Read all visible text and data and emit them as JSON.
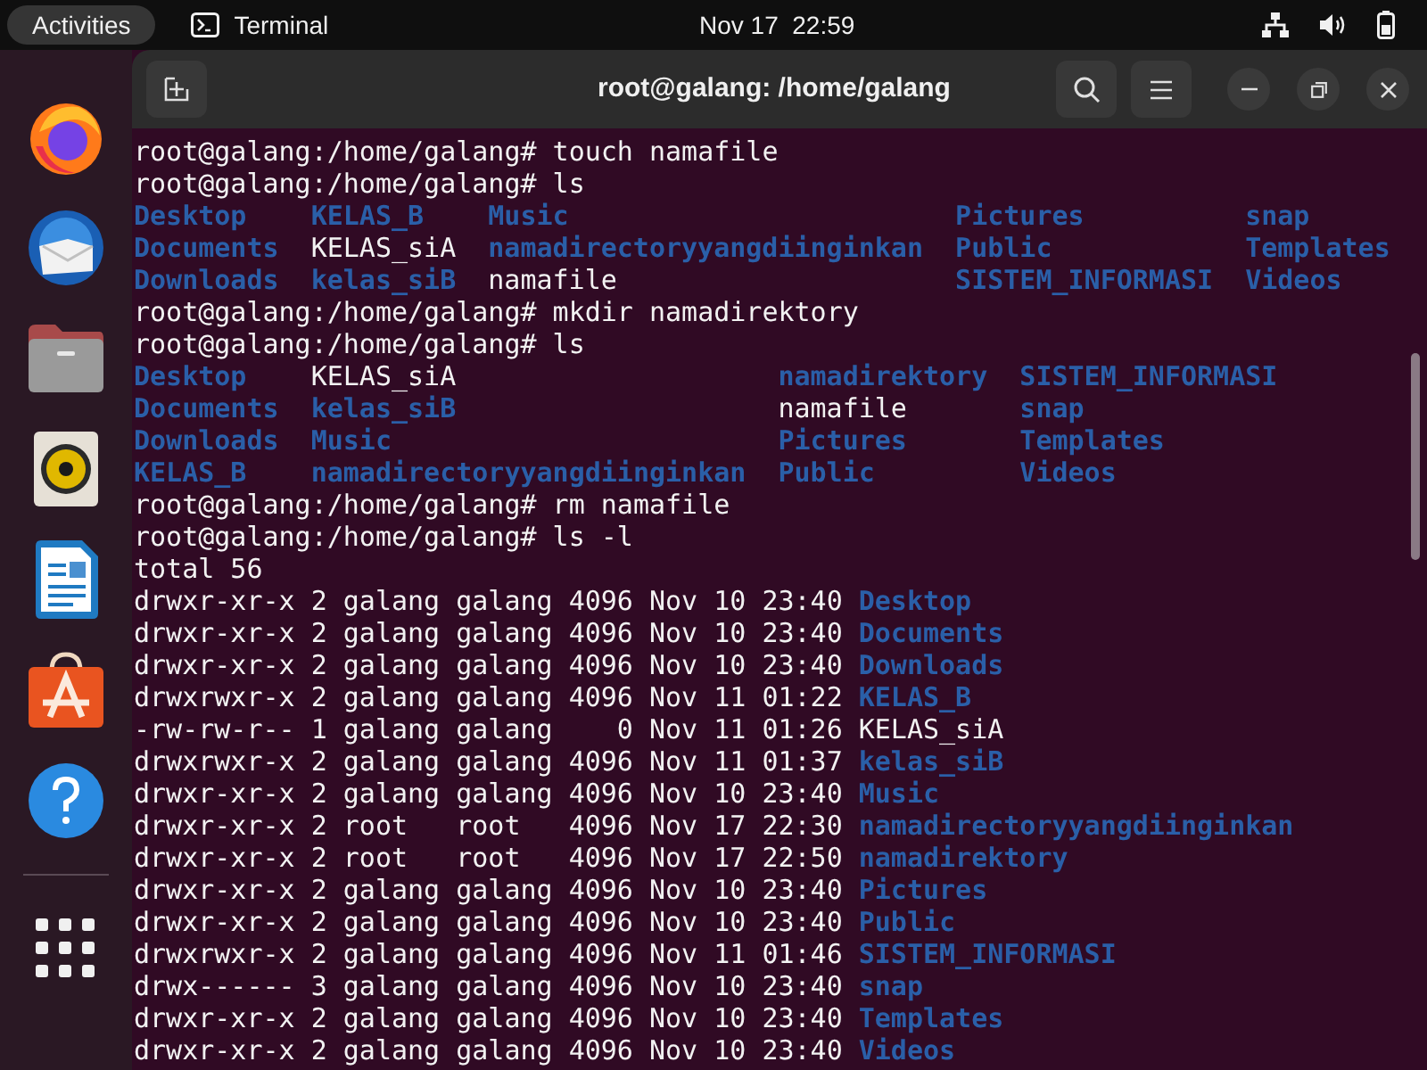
{
  "top_bar": {
    "activities": "Activities",
    "app_name": "Terminal",
    "clock": "Nov 17  22:59"
  },
  "dock": {
    "apps": [
      {
        "kind": "firefox",
        "selected": false
      },
      {
        "kind": "thunderbird",
        "selected": false
      },
      {
        "kind": "files",
        "selected": false
      },
      {
        "kind": "rhythmbox",
        "selected": false
      },
      {
        "kind": "writer",
        "selected": false
      },
      {
        "kind": "appcenter",
        "selected": false
      },
      {
        "kind": "help",
        "selected": false
      }
    ]
  },
  "window": {
    "title": "root@galang: /home/galang"
  },
  "terminal": {
    "lines": [
      {
        "kind": "prompt",
        "prompt": "root@galang:/home/galang#",
        "command": "touch namafile"
      },
      {
        "kind": "prompt",
        "prompt": "root@galang:/home/galang#",
        "command": "ls"
      },
      {
        "kind": "grid",
        "rows": [
          [
            {
              "name": "Desktop",
              "directory": true
            },
            {
              "name": "KELAS_B",
              "directory": true
            },
            {
              "name": "Music",
              "directory": true
            },
            {
              "name": "Pictures",
              "directory": true
            },
            {
              "name": "snap",
              "directory": true
            }
          ],
          [
            {
              "name": "Documents",
              "directory": true
            },
            {
              "name": "KELAS_siA",
              "directory": false
            },
            {
              "name": "namadirectoryyangdiinginkan",
              "directory": true
            },
            {
              "name": "Public",
              "directory": true
            },
            {
              "name": "Templates",
              "directory": true
            }
          ],
          [
            {
              "name": "Downloads",
              "directory": true
            },
            {
              "name": "kelas_siB",
              "directory": true
            },
            {
              "name": "namafile",
              "directory": false
            },
            {
              "name": "SISTEM_INFORMASI",
              "directory": true
            },
            {
              "name": "Videos",
              "directory": true
            }
          ]
        ]
      },
      {
        "kind": "prompt",
        "prompt": "root@galang:/home/galang#",
        "command": "mkdir namadirektory"
      },
      {
        "kind": "prompt",
        "prompt": "root@galang:/home/galang#",
        "command": "ls"
      },
      {
        "kind": "grid",
        "rows": [
          [
            {
              "name": "Desktop",
              "directory": true
            },
            {
              "name": "KELAS_siA",
              "directory": false
            },
            {
              "name": "namadirektory",
              "directory": true
            },
            {
              "name": "SISTEM_INFORMASI",
              "directory": true
            }
          ],
          [
            {
              "name": "Documents",
              "directory": true
            },
            {
              "name": "kelas_siB",
              "directory": true
            },
            {
              "name": "namafile",
              "directory": false
            },
            {
              "name": "snap",
              "directory": true
            }
          ],
          [
            {
              "name": "Downloads",
              "directory": true
            },
            {
              "name": "Music",
              "directory": true
            },
            {
              "name": "Pictures",
              "directory": true
            },
            {
              "name": "Templates",
              "directory": true
            }
          ],
          [
            {
              "name": "KELAS_B",
              "directory": true
            },
            {
              "name": "namadirectoryyangdiinginkan",
              "directory": true
            },
            {
              "name": "Public",
              "directory": true
            },
            {
              "name": "Videos",
              "directory": true
            }
          ]
        ]
      },
      {
        "kind": "prompt",
        "prompt": "root@galang:/home/galang#",
        "command": "rm namafile"
      },
      {
        "kind": "prompt",
        "prompt": "root@galang:/home/galang#",
        "command": "ls -l"
      },
      {
        "kind": "output",
        "text": "total 56"
      },
      {
        "kind": "long",
        "info": "drwxr-xr-x 2 galang galang 4096 Nov 10 23:40",
        "name": "Desktop",
        "directory": true
      },
      {
        "kind": "long",
        "info": "drwxr-xr-x 2 galang galang 4096 Nov 10 23:40",
        "name": "Documents",
        "directory": true
      },
      {
        "kind": "long",
        "info": "drwxr-xr-x 2 galang galang 4096 Nov 10 23:40",
        "name": "Downloads",
        "directory": true
      },
      {
        "kind": "long",
        "info": "drwxrwxr-x 2 galang galang 4096 Nov 11 01:22",
        "name": "KELAS_B",
        "directory": true
      },
      {
        "kind": "long",
        "info": "-rw-rw-r-- 1 galang galang    0 Nov 11 01:26",
        "name": "KELAS_siA",
        "directory": false
      },
      {
        "kind": "long",
        "info": "drwxrwxr-x 2 galang galang 4096 Nov 11 01:37",
        "name": "kelas_siB",
        "directory": true
      },
      {
        "kind": "long",
        "info": "drwxr-xr-x 2 galang galang 4096 Nov 10 23:40",
        "name": "Music",
        "directory": true
      },
      {
        "kind": "long",
        "info": "drwxr-xr-x 2 root   root   4096 Nov 17 22:30",
        "name": "namadirectoryyangdiinginkan",
        "directory": true
      },
      {
        "kind": "long",
        "info": "drwxr-xr-x 2 root   root   4096 Nov 17 22:50",
        "name": "namadirektory",
        "directory": true
      },
      {
        "kind": "long",
        "info": "drwxr-xr-x 2 galang galang 4096 Nov 10 23:40",
        "name": "Pictures",
        "directory": true
      },
      {
        "kind": "long",
        "info": "drwxr-xr-x 2 galang galang 4096 Nov 10 23:40",
        "name": "Public",
        "directory": true
      },
      {
        "kind": "long",
        "info": "drwxrwxr-x 2 galang galang 4096 Nov 11 01:46",
        "name": "SISTEM_INFORMASI",
        "directory": true
      },
      {
        "kind": "long",
        "info": "drwx------ 3 galang galang 4096 Nov 10 23:40",
        "name": "snap",
        "directory": true
      },
      {
        "kind": "long",
        "info": "drwxr-xr-x 2 galang galang 4096 Nov 10 23:40",
        "name": "Templates",
        "directory": true
      },
      {
        "kind": "long",
        "info": "drwxr-xr-x 2 galang galang 4096 Nov 10 23:40",
        "name": "Videos",
        "directory": true
      }
    ]
  }
}
